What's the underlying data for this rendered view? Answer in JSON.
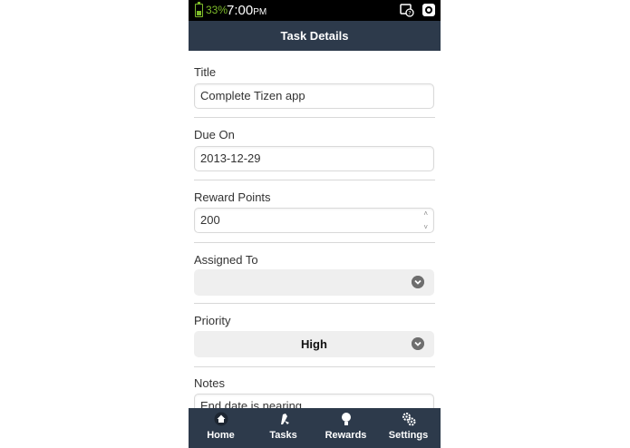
{
  "status": {
    "battery": "33%",
    "time": "7:00",
    "ampm": "PM"
  },
  "header": {
    "title": "Task Details"
  },
  "form": {
    "title_label": "Title",
    "title_value": "Complete Tizen app",
    "due_label": "Due On",
    "due_value": "2013-12-29",
    "points_label": "Reward Points",
    "points_value": "200",
    "assigned_label": "Assigned To",
    "assigned_value": "",
    "priority_label": "Priority",
    "priority_value": "High",
    "notes_label": "Notes",
    "notes_value": "End date is nearing"
  },
  "tabs": [
    {
      "label": "Home",
      "icon": "home-icon"
    },
    {
      "label": "Tasks",
      "icon": "tasks-icon"
    },
    {
      "label": "Rewards",
      "icon": "rewards-icon"
    },
    {
      "label": "Settings",
      "icon": "settings-icon"
    }
  ],
  "colors": {
    "header_bg": "#2d3a4b",
    "battery": "#7dbb2a",
    "select_bg": "#efefef"
  }
}
